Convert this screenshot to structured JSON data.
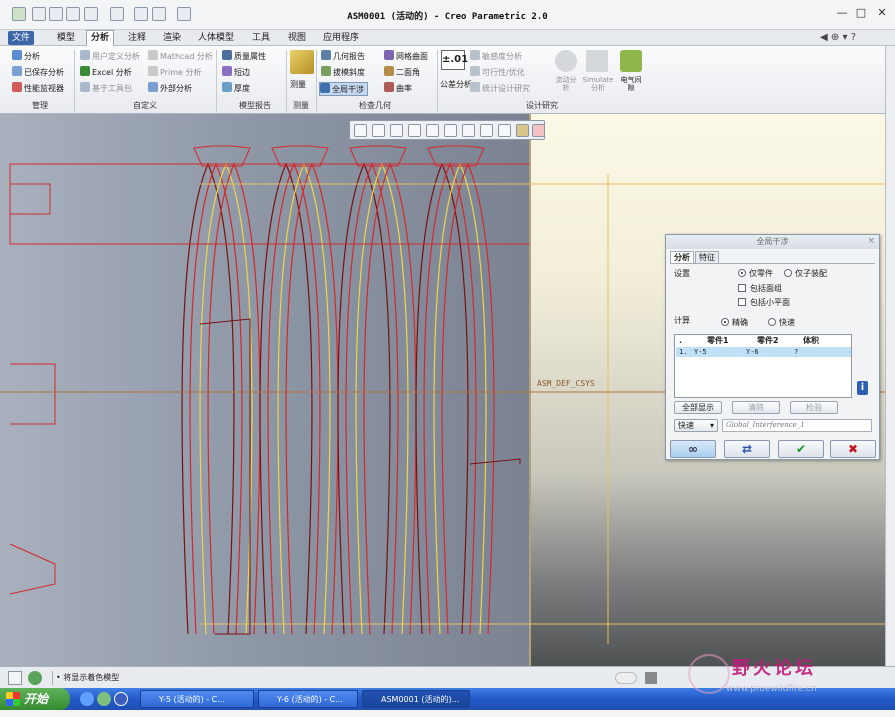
{
  "window": {
    "title": "ASM0001 (活动的) - Creo Parametric 2.0",
    "controls": [
      "—",
      "□",
      "✕"
    ],
    "help_icons": [
      "◀",
      "⊕",
      "▾",
      "?"
    ]
  },
  "menu": {
    "file": "文件",
    "tabs": [
      "模型",
      "分析",
      "注释",
      "渲染",
      "人体模型",
      "工具",
      "视图",
      "应用程序"
    ],
    "active": "分析"
  },
  "ribbon": {
    "manage": {
      "items": [
        "分析",
        "已保存分析",
        "性能监视器"
      ],
      "label": "管理"
    },
    "custom": {
      "items": [
        "用户定义分析",
        "Excel 分析",
        "基于工具包",
        "Mathcad 分析",
        "Prime 分析",
        "外部分析"
      ],
      "label": "自定义"
    },
    "model_report": {
      "items": [
        "质量属性",
        "短边",
        "厚度"
      ],
      "label": "模型报告"
    },
    "measure": {
      "label": "测量",
      "button": "测量"
    },
    "inspect": {
      "items": [
        "几何报告",
        "拔模斜度",
        "全局干涉",
        "网格曲面",
        "二面角",
        "曲率"
      ],
      "label": "检查几何"
    },
    "tolerance": {
      "button": "公差分析",
      "symbol": "±.01"
    },
    "design_study": {
      "items": [
        "敏感度分析",
        "可行性/优化",
        "统计设计研究"
      ],
      "label": "设计研究"
    },
    "sim": {
      "items": [
        "流动分析",
        "Simulate 分析",
        "电气间隙"
      ]
    }
  },
  "viewport": {
    "csys_label": "ASM_DEF_CSYS",
    "colors": {
      "coil": "#d22a2a",
      "coil_dark": "#7a1010",
      "coil_yellow": "#f2d34a",
      "hidden": "#e8c060"
    }
  },
  "dialog": {
    "title": "全局干涉",
    "tabs": [
      "分析",
      "特征"
    ],
    "settings_label": "设置",
    "radio_parts_only": "仅零件",
    "radio_subasm_only": "仅子装配",
    "chk_include_facets": "包括面组",
    "chk_include_quilts": "包括小平面",
    "compute_label": "计算",
    "radio_exact": "精确",
    "radio_quick": "快速",
    "table": {
      "headers": [
        "零件1",
        "零件2",
        "体积"
      ],
      "rows": [
        {
          "idx": "1.",
          "part1": "Y-5",
          "part2": "Y-6",
          "vol": "?"
        }
      ]
    },
    "btn_show_all": "全部显示",
    "btn_clear": "清除",
    "btn_check": "检验",
    "mode_select": "快速",
    "name_field": "Global_Interference_1"
  },
  "status": {
    "message": "将显示着色模型"
  },
  "taskbar": {
    "start": "开始",
    "tasks": [
      "Y-5 (活动的) - C...",
      "Y-6 (活动的) - C...",
      "ASM0001 (活动的)..."
    ]
  },
  "watermark": {
    "text": "野火论坛",
    "url": "www.proewildfire.cn"
  }
}
